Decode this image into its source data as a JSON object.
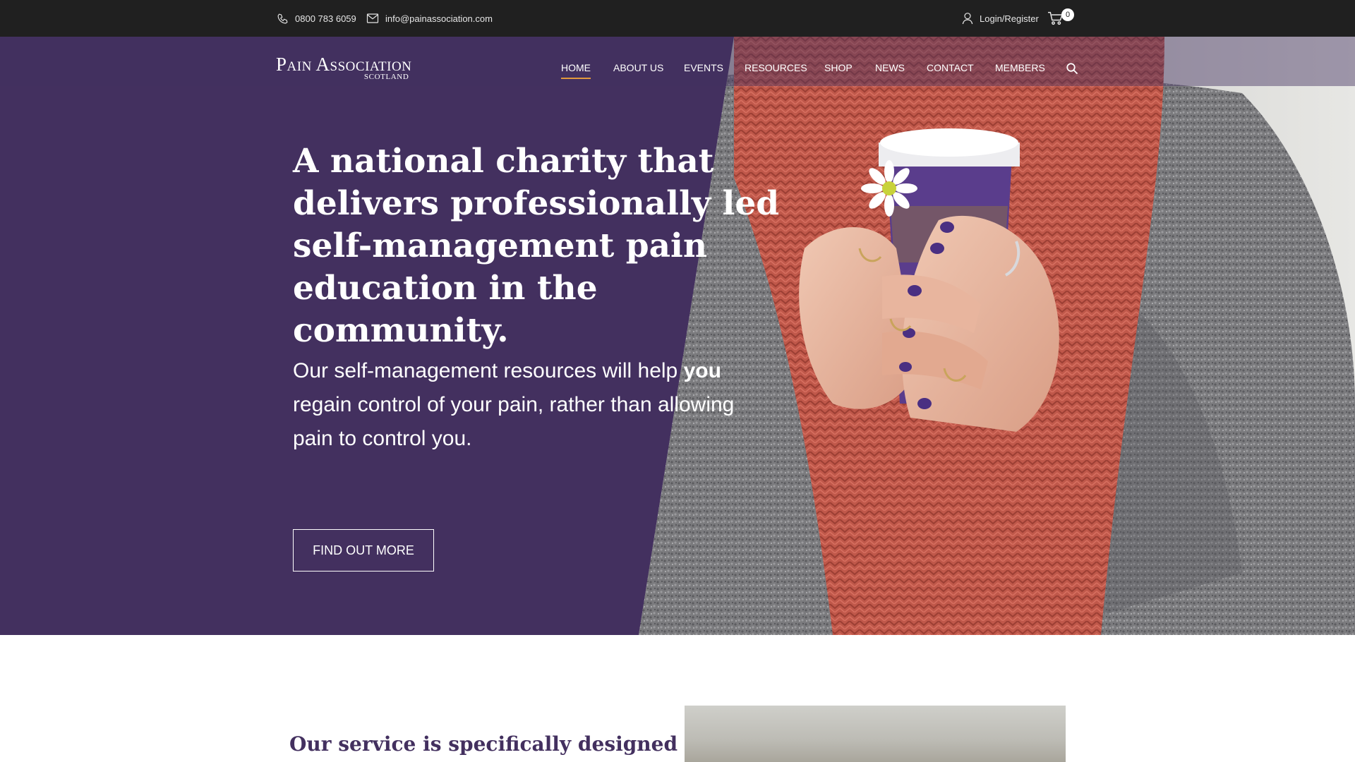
{
  "topbar": {
    "phone": "0800 783 6059",
    "email": "info@painassociation.com",
    "login_label": "Login/Register",
    "cart_count": "0",
    "icons": [
      "phone-icon",
      "mail-icon",
      "user-icon",
      "cart-icon"
    ]
  },
  "header": {
    "logo_main": "Pain Association",
    "logo_sub": "SCOTLAND",
    "nav": [
      {
        "label": "HOME",
        "active": true
      },
      {
        "label": "ABOUT US"
      },
      {
        "label": "EVENTS"
      },
      {
        "label": "RESOURCES"
      },
      {
        "label": "SHOP"
      },
      {
        "label": "NEWS"
      },
      {
        "label": "CONTACT"
      },
      {
        "label": "MEMBERS"
      }
    ],
    "search_icon": "search-icon"
  },
  "hero": {
    "headline": "A national charity that delivers professionally led self-management pain education in the community.",
    "subtext_before": "Our self-management resources will help",
    "subtext_bold": "you",
    "subtext_after": "regain control of your pain, rather than allowing pain to control you.",
    "cta_label": "FIND OUT MORE"
  },
  "section": {
    "heading": "Our service is specifically designed"
  },
  "colors": {
    "topbar": "#202020",
    "brand_purple": "#43305f",
    "nav_active_underline": "#e29a3d",
    "scarf": "#c2594a",
    "sweater": "#7d7d80"
  }
}
